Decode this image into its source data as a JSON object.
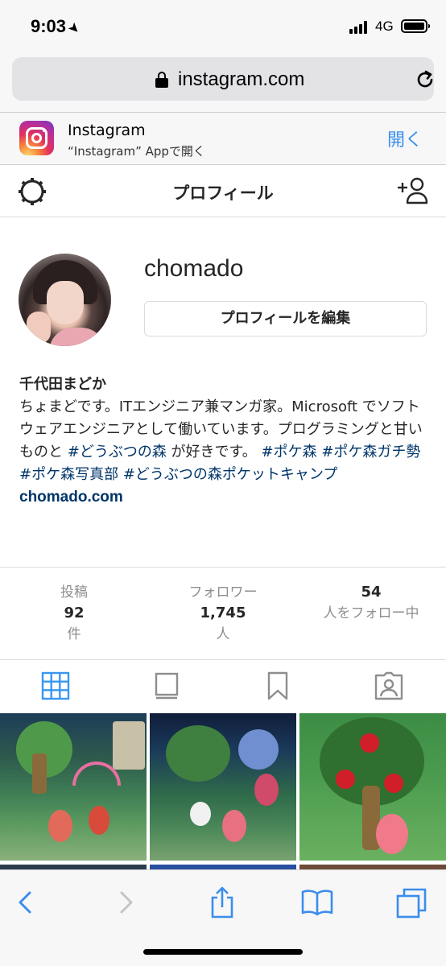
{
  "status_bar": {
    "time": "9:03",
    "network": "4G"
  },
  "browser": {
    "url": "instagram.com"
  },
  "app_banner": {
    "name": "Instagram",
    "subtitle": "“Instagram” Appで開く",
    "open_label": "開く"
  },
  "header": {
    "title": "プロフィール"
  },
  "profile": {
    "username": "chomado",
    "edit_button": "プロフィールを編集",
    "full_name": "千代田まどか",
    "bio_1": "ちょまどです。ITエンジニア兼マンガ家。Microsoft でソフトウェアエンジニアとして働いています。プログラミングと甘いものと ",
    "tag_1": "#どうぶつの森",
    "bio_2": " が好きです。 ",
    "tag_2": "#ポケ森",
    "tag_3": "#ポケ森ガチ勢",
    "tag_4": "#ポケ森写真部",
    "tag_5": "#どうぶつの森ポケットキャンプ",
    "website": "chomado.com"
  },
  "stats": [
    {
      "label": "投稿",
      "value": "92",
      "unit": "件"
    },
    {
      "label": "フォロワー",
      "value": "1,745",
      "unit": "人"
    },
    {
      "value": "54",
      "label": "人をフォロー中"
    }
  ],
  "colors": {
    "accent": "#3897f0",
    "link": "#003569",
    "safari_blue": "#3b8ded"
  }
}
